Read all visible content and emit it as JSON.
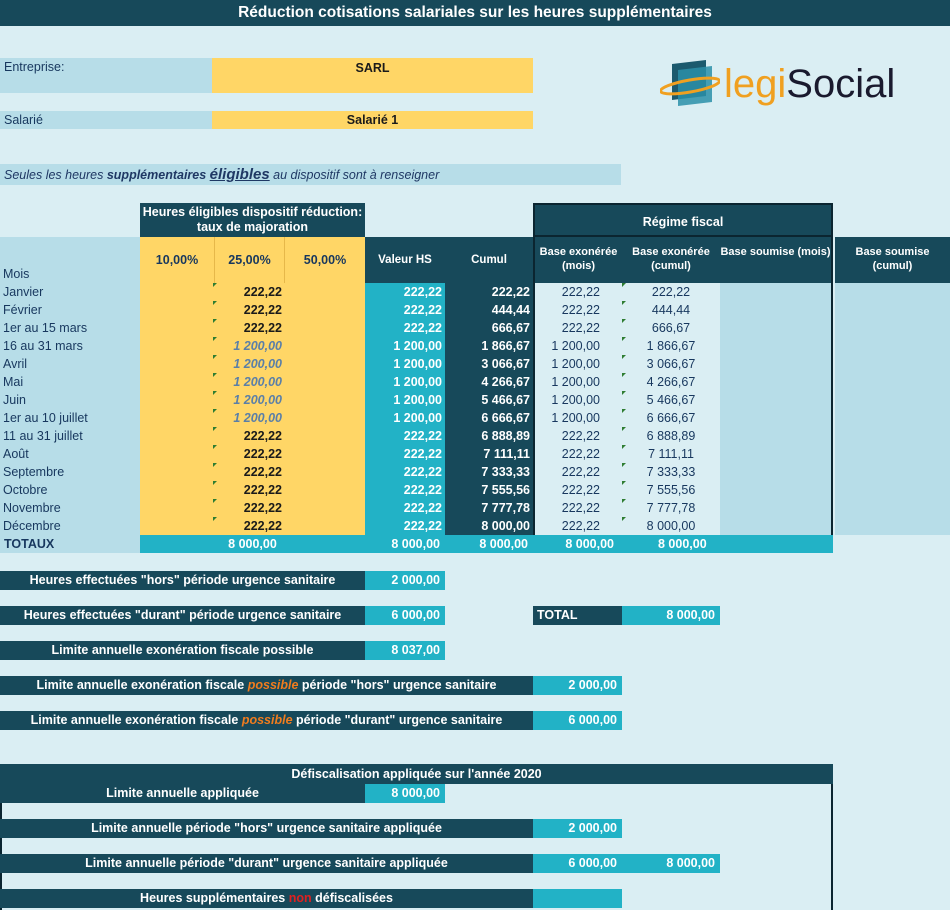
{
  "title": "Réduction cotisations salariales sur les heures supplémentaires",
  "entreprise": {
    "label": "Entreprise:",
    "value": "SARL"
  },
  "salarie": {
    "label": "Salarié",
    "value": "Salarié 1"
  },
  "notice": {
    "part1": "Seules les heures ",
    "part2": "supplémentaires",
    "part3": "éligibles",
    "part4": " au dispositif sont à renseigner"
  },
  "logo": {
    "part1": "legi",
    "part2": "Social"
  },
  "headers": {
    "eligible": "Heures éligibles dispositif réduction: taux de majoration",
    "rate10": "10,00%",
    "rate25": "25,00%",
    "rate50": "50,00%",
    "valeur_hs": "Valeur HS",
    "cumul": "Cumul",
    "regime_fiscal": "Régime fiscal",
    "base_exo_mois": "Base exonérée (mois)",
    "base_exo_cumul": "Base exonérée (cumul)",
    "base_soumise_mois": "Base soumise (mois)",
    "base_soumise_cumul": "Base soumise (cumul)",
    "mois": "Mois"
  },
  "rows": [
    {
      "mois": "Janvier",
      "r25": "222,22",
      "italic": false,
      "valeur": "222,22",
      "cumul": "222,22",
      "exo_mois": "222,22",
      "exo_cumul": "222,22"
    },
    {
      "mois": "Février",
      "r25": "222,22",
      "italic": false,
      "valeur": "222,22",
      "cumul": "444,44",
      "exo_mois": "222,22",
      "exo_cumul": "444,44"
    },
    {
      "mois": "1er au 15 mars",
      "r25": "222,22",
      "italic": false,
      "valeur": "222,22",
      "cumul": "666,67",
      "exo_mois": "222,22",
      "exo_cumul": "666,67"
    },
    {
      "mois": "16 au 31 mars",
      "r25": "1 200,00",
      "italic": true,
      "valeur": "1 200,00",
      "cumul": "1 866,67",
      "exo_mois": "1 200,00",
      "exo_cumul": "1 866,67"
    },
    {
      "mois": "Avril",
      "r25": "1 200,00",
      "italic": true,
      "valeur": "1 200,00",
      "cumul": "3 066,67",
      "exo_mois": "1 200,00",
      "exo_cumul": "3 066,67"
    },
    {
      "mois": "Mai",
      "r25": "1 200,00",
      "italic": true,
      "valeur": "1 200,00",
      "cumul": "4 266,67",
      "exo_mois": "1 200,00",
      "exo_cumul": "4 266,67"
    },
    {
      "mois": "Juin",
      "r25": "1 200,00",
      "italic": true,
      "valeur": "1 200,00",
      "cumul": "5 466,67",
      "exo_mois": "1 200,00",
      "exo_cumul": "5 466,67"
    },
    {
      "mois": "1er au 10 juillet",
      "r25": "1 200,00",
      "italic": true,
      "valeur": "1 200,00",
      "cumul": "6 666,67",
      "exo_mois": "1 200,00",
      "exo_cumul": "6 666,67"
    },
    {
      "mois": "11 au 31 juillet",
      "r25": "222,22",
      "italic": false,
      "valeur": "222,22",
      "cumul": "6 888,89",
      "exo_mois": "222,22",
      "exo_cumul": "6 888,89"
    },
    {
      "mois": "Août",
      "r25": "222,22",
      "italic": false,
      "valeur": "222,22",
      "cumul": "7 111,11",
      "exo_mois": "222,22",
      "exo_cumul": "7 111,11"
    },
    {
      "mois": "Septembre",
      "r25": "222,22",
      "italic": false,
      "valeur": "222,22",
      "cumul": "7 333,33",
      "exo_mois": "222,22",
      "exo_cumul": "7 333,33"
    },
    {
      "mois": "Octobre",
      "r25": "222,22",
      "italic": false,
      "valeur": "222,22",
      "cumul": "7 555,56",
      "exo_mois": "222,22",
      "exo_cumul": "7 555,56"
    },
    {
      "mois": "Novembre",
      "r25": "222,22",
      "italic": false,
      "valeur": "222,22",
      "cumul": "7 777,78",
      "exo_mois": "222,22",
      "exo_cumul": "7 777,78"
    },
    {
      "mois": "Décembre",
      "r25": "222,22",
      "italic": false,
      "valeur": "222,22",
      "cumul": "8 000,00",
      "exo_mois": "222,22",
      "exo_cumul": "8 000,00"
    }
  ],
  "totals": {
    "label": "TOTAUX",
    "heures": "8 000,00",
    "valeur": "8 000,00",
    "cumul": "8 000,00",
    "exo_mois": "8 000,00",
    "exo_cumul": "8 000,00"
  },
  "summary": {
    "hors_label": "Heures effectuées \"hors\" période urgence sanitaire",
    "hors_value": "2 000,00",
    "durant_label": "Heures effectuées \"durant\" période urgence sanitaire",
    "durant_value": "6 000,00",
    "total_label": "TOTAL",
    "total_value": "8 000,00",
    "limite_label": "Limite annuelle exonération fiscale possible",
    "limite_value": "8 037,00",
    "limite_hors_pre": "Limite annuelle exonération fiscale ",
    "limite_hors_mid": "possible",
    "limite_hors_post": " période \"hors\" urgence sanitaire",
    "limite_hors_value": "2 000,00",
    "limite_durant_pre": "Limite annuelle exonération fiscale ",
    "limite_durant_mid": "possible",
    "limite_durant_post": " période \"durant\" urgence sanitaire",
    "limite_durant_value": "6 000,00"
  },
  "defisc": {
    "header": "Défiscalisation appliquée sur l'année 2020",
    "limite_appliquee_label": "Limite annuelle appliquée",
    "limite_appliquee_value": "8 000,00",
    "limite_hors_label": "Limite annuelle période \"hors\" urgence sanitaire appliquée",
    "limite_hors_value": "2 000,00",
    "limite_durant_label": "Limite annuelle période \"durant\" urgence sanitaire appliquée",
    "limite_durant_value": "6 000,00",
    "limite_durant_total": "8 000,00",
    "non_defisc_pre": "Heures supplémentaires ",
    "non_defisc_mid": "non",
    "non_defisc_post": " défiscalisées",
    "non_defisc_value": ""
  }
}
